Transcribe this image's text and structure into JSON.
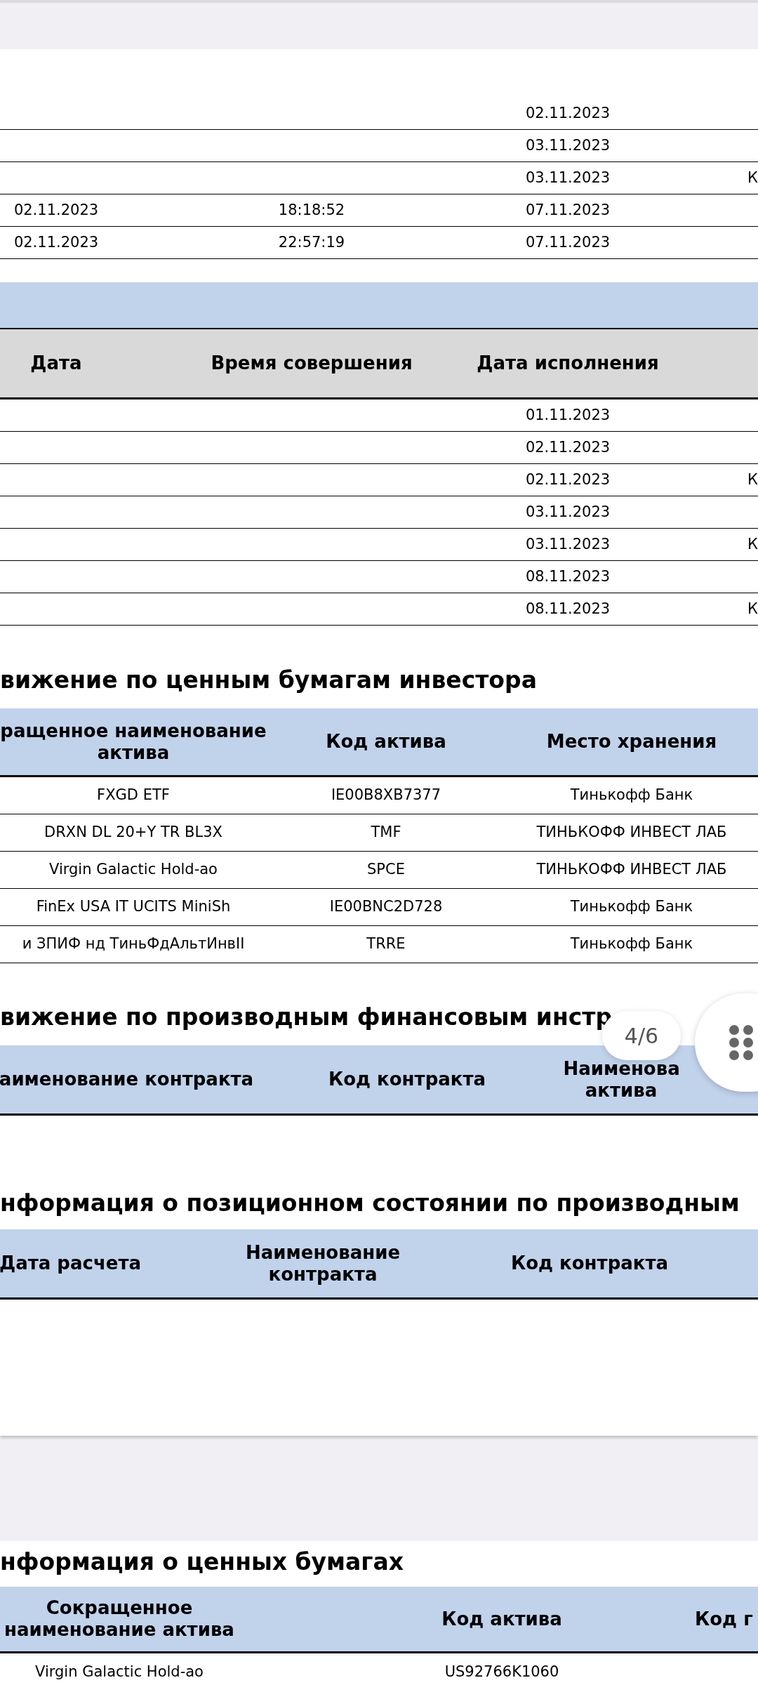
{
  "viewer": {
    "page_indicator": "4/6"
  },
  "page_1": {
    "table_1": {
      "rows": [
        {
          "column_3": "02.11.2023"
        },
        {
          "column_3": "03.11.2023"
        },
        {
          "column_3": "03.11.2023",
          "column_4": "К"
        },
        {
          "column_1": "02.11.2023",
          "column_2": "18:18:52",
          "column_3": "07.11.2023"
        },
        {
          "column_1": "02.11.2023",
          "column_2": "22:57:19",
          "column_3": "07.11.2023"
        }
      ]
    },
    "table_2": {
      "columns": [
        "Дата",
        "Время совершения",
        "Дата исполнения"
      ],
      "rows": [
        {
          "column_3": "01.11.2023"
        },
        {
          "column_3": "02.11.2023"
        },
        {
          "column_3": "02.11.2023",
          "column_4": "К"
        },
        {
          "column_3": "03.11.2023"
        },
        {
          "column_3": "03.11.2023",
          "column_4": "К"
        },
        {
          "column_3": "08.11.2023"
        },
        {
          "column_3": "08.11.2023",
          "column_4": "К"
        }
      ]
    },
    "securities": {
      "title": "вижение по ценным бумагам инвестора",
      "columns": [
        "ращенное наименование актива",
        "Код актива",
        "Место хранения"
      ],
      "rows": [
        {
          "column_1": "FXGD ETF",
          "column_2": "IE00B8XB7377",
          "column_3": "Тинькофф Банк"
        },
        {
          "column_1": "DRXN DL 20+Y TR BL3X",
          "column_2": "TMF",
          "column_3": "ТИНЬКОФФ ИНВЕСТ ЛАБ"
        },
        {
          "column_1": "Virgin Galactic Hold-ao",
          "column_2": "SPCE",
          "column_3": "ТИНЬКОФФ ИНВЕСТ ЛАБ"
        },
        {
          "column_1": "FinEx USA IT UCITS MiniSh",
          "column_2": "IE00BNC2D728",
          "column_3": "Тинькофф Банк"
        },
        {
          "column_1": "и ЗПИФ нд ТиньФдАльтИнвII",
          "column_2": "TRRE",
          "column_3": "Тинькофф Банк"
        }
      ]
    },
    "derivatives": {
      "title": "вижение по производным финансовым инстр",
      "columns": [
        "аименование контракта",
        "Код контракта",
        "Наименова актива"
      ]
    },
    "positions": {
      "title": "нформация о позиционном состоянии по производным",
      "columns": [
        "Дата расчета",
        "Наименование контракта",
        "Код контракта"
      ]
    }
  },
  "page_2": {
    "securities_info": {
      "title": "нформация о ценных бумагах",
      "columns": [
        "Сокращенное наименование актива",
        "Код актива",
        "Код г"
      ],
      "rows": [
        {
          "column_1": "Virgin Galactic Hold-ao",
          "column_2": "US92766K1060"
        }
      ]
    }
  }
}
